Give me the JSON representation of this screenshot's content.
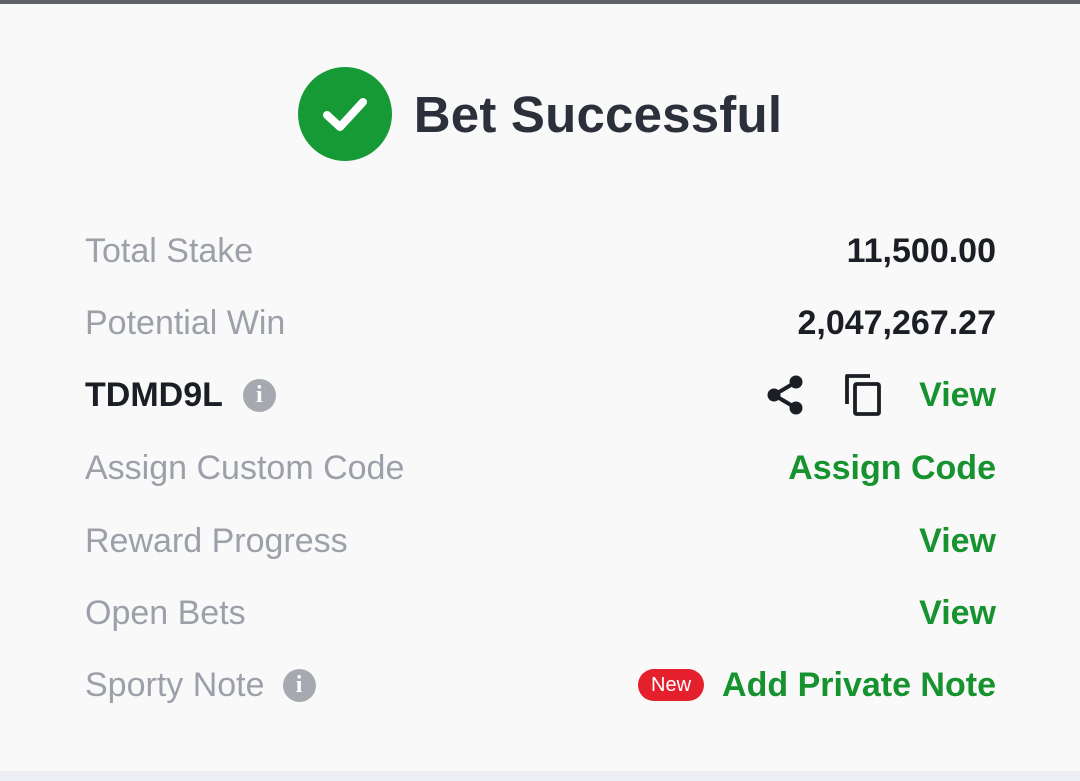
{
  "header": {
    "title": "Bet Successful",
    "icon": "check-circle-icon",
    "accent_color": "#169a36"
  },
  "summary": {
    "total_stake_label": "Total Stake",
    "total_stake_value": "11,500.00",
    "potential_win_label": "Potential Win",
    "potential_win_value": "2,047,267.27"
  },
  "booking": {
    "code": "TDMD9L",
    "info_icon": "info-icon",
    "share_icon": "share-icon",
    "copy_icon": "copy-icon",
    "view_label": "View"
  },
  "custom_code": {
    "label": "Assign Custom Code",
    "action_label": "Assign Code"
  },
  "reward_progress": {
    "label": "Reward Progress",
    "action_label": "View"
  },
  "open_bets": {
    "label": "Open Bets",
    "action_label": "View"
  },
  "sporty_note": {
    "label": "Sporty Note",
    "info_icon": "info-icon",
    "badge": "New",
    "badge_color": "#e4202c",
    "action_label": "Add Private Note"
  },
  "colors": {
    "link": "#16932f",
    "muted_text": "#9ca0a9",
    "dark_text": "#1b1e24"
  }
}
